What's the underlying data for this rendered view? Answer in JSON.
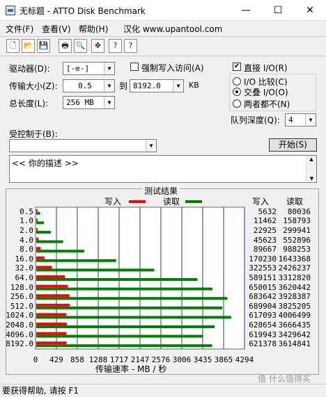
{
  "window": {
    "title": "无标题 - ATTO Disk Benchmark",
    "minimize": "—",
    "maximize": "☐",
    "close": "✕"
  },
  "menu": {
    "file": "文件(F)",
    "view": "查看(V)",
    "help": "帮助(H)",
    "credit": "汉化 www.upantool.com"
  },
  "toolbar": {
    "new": "🗋",
    "open": "📂",
    "save": "💾",
    "print": "🖶",
    "preview": "🔍",
    "move": "✥",
    "help": "?",
    "context_help": "?"
  },
  "form": {
    "drive_label": "驱动器(D):",
    "drive_value": "[-e-]",
    "force_write_label": "强制写入访问(A)",
    "direct_io_label": "直接 I/O(R)",
    "direct_io_checked": "✔",
    "transfer_label": "传输大小(Z):",
    "transfer_from": "0.5",
    "transfer_to_label": "到",
    "transfer_to": "8192.0",
    "transfer_unit": "KB",
    "total_label": "总长度(L):",
    "total_value": "256 MB",
    "io_compare_label": "I/O 比较(C)",
    "overlap_io_label": "交叠 I/O(O)",
    "neither_label": "两者都不(N)",
    "queue_label": "队列深度(Q):",
    "queue_value": "4",
    "controlled_label": "受控制于(B):",
    "controlled_value": "",
    "start_label": "开始(S)",
    "description": "<<  你的描述  >>"
  },
  "results": {
    "title": "测试结果",
    "write_legend": "写入",
    "read_legend": "读取",
    "write_col": "写入",
    "read_col": "读取",
    "write_color": "#ff0000",
    "read_color": "#008000"
  },
  "chart_data": {
    "type": "bar",
    "title": "测试结果",
    "xlabel": "传输速率 - MB / 秒",
    "ylabel": "",
    "categories": [
      "0.5",
      "1.0",
      "2.0",
      "4.0",
      "8.0",
      "16.0",
      "32.0",
      "64.0",
      "128.0",
      "256.0",
      "512.0",
      "1024.0",
      "2048.0",
      "4096.0",
      "8192.0"
    ],
    "series": [
      {
        "name": "写入",
        "values": [
          5632,
          11462,
          22925,
          45623,
          89667,
          170230,
          322553,
          589151,
          650015,
          683642,
          689904,
          617093,
          628654,
          619943,
          621378
        ]
      },
      {
        "name": "读取",
        "values": [
          80036,
          158793,
          299941,
          552896,
          988253,
          1643368,
          2426237,
          3312820,
          3620442,
          3928387,
          3825205,
          4006499,
          3666435,
          3429642,
          3614841
        ]
      }
    ],
    "x_ticks": [
      "0",
      "429",
      "858",
      "1288",
      "1717",
      "2147",
      "2576",
      "3006",
      "3435",
      "3865",
      "4294"
    ],
    "xlim": [
      0,
      4294
    ],
    "bar_scale": 1000,
    "grid": true
  },
  "status": {
    "text": "要获得帮助, 请按 F1"
  },
  "watermark": {
    "text": "值 什么值得买"
  }
}
